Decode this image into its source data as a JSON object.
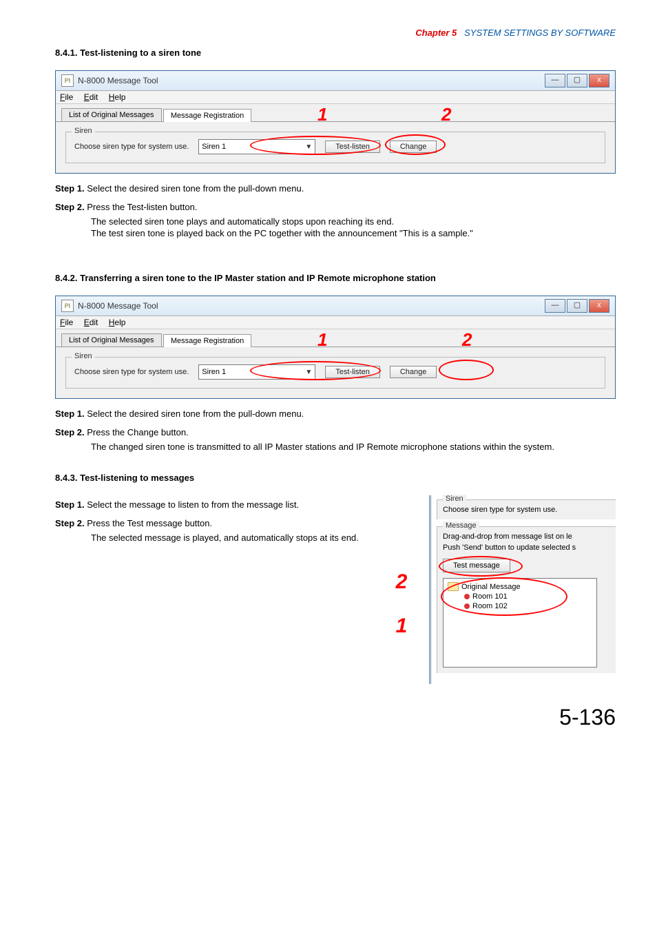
{
  "chapter": {
    "label": "Chapter 5",
    "title": "SYSTEM SETTINGS BY SOFTWARE"
  },
  "sec841": {
    "heading": "8.4.1. Test-listening to a siren tone",
    "step1": "Step 1. Select the desired siren tone from the pull-down menu.",
    "step2": "Step 2. Press the Test-listen button.",
    "step2a": "The selected siren tone plays and automatically stops upon reaching its end.",
    "step2b": "The test siren tone is played back on the PC together with the announcement \"This is a sample.\""
  },
  "sec842": {
    "heading": "8.4.2. Transferring a siren tone to the IP Master station and IP Remote microphone station",
    "step1": "Step 1. Select the desired siren tone from the pull-down menu.",
    "step2": "Step 2. Press the Change button.",
    "step2a": "The changed siren tone is transmitted to all IP Master stations and IP Remote microphone stations within the system."
  },
  "sec843": {
    "heading": "8.4.3. Test-listening to messages",
    "step1": "Step 1. Select the message to listen to from the message list.",
    "step2": "Step 2. Press the Test message button.",
    "step2a": "The selected message is played, and automatically stops at its end."
  },
  "window": {
    "app_icon": "PI",
    "title": "N-8000 Message Tool",
    "menu": {
      "file": "File",
      "edit": "Edit",
      "help": "Help"
    },
    "tabs": {
      "original": "List of Original Messages",
      "reg": "Message Registration"
    },
    "siren_group": "Siren",
    "siren_label": "Choose siren type for system use.",
    "siren_value": "Siren 1",
    "test_listen": "Test-listen",
    "change": "Change"
  },
  "panel": {
    "siren_group": "Siren",
    "siren_label": "Choose siren type for system use.",
    "msg_group": "Message",
    "msg_hint1": "Drag-and-drop from message list on le",
    "msg_hint2": "Push 'Send' button to update selected s",
    "test_msg": "Test message",
    "tree_root": "Original Message",
    "tree_item1": "Room 101",
    "tree_item2": "Room 102"
  },
  "callouts": {
    "n1": "1",
    "n2": "2"
  },
  "page_number": "5-136"
}
